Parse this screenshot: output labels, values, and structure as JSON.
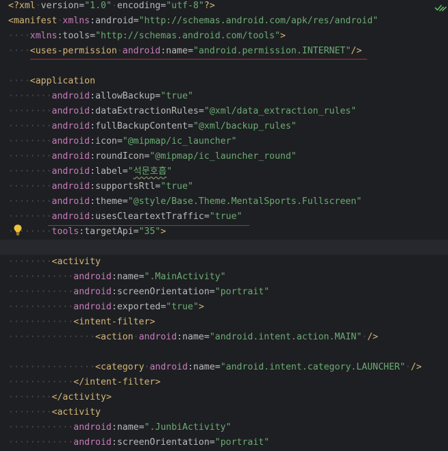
{
  "editor": {
    "lines": [
      "<?xml version=\"1.0\" encoding=\"utf-8\"?>",
      "<manifest xmlns:android=\"http://schemas.android.com/apk/res/android\"",
      "    xmlns:tools=\"http://schemas.android.com/tools\">",
      "    <uses-permission android:name=\"android.permission.INTERNET\"/>",
      "",
      "    <application",
      "        android:allowBackup=\"true\"",
      "        android:dataExtractionRules=\"@xml/data_extraction_rules\"",
      "        android:fullBackupContent=\"@xml/backup_rules\"",
      "        android:icon=\"@mipmap/ic_launcher\"",
      "        android:roundIcon=\"@mipmap/ic_launcher_round\"",
      "        android:label=\"석문호흡\"",
      "        android:supportsRtl=\"true\"",
      "        android:theme=\"@style/Base.Theme.MentalSports.Fullscreen\"",
      "        android:usesCleartextTraffic=\"true\"",
      "        tools:targetApi=\"35\">",
      "",
      "        <activity",
      "            android:name=\".MainActivity\"",
      "            android:screenOrientation=\"portrait\"",
      "            android:exported=\"true\">",
      "            <intent-filter>",
      "                <action android:name=\"android.intent.action.MAIN\" />",
      "",
      "                <category android:name=\"android.intent.category.LAUNCHER\" />",
      "            </intent-filter>",
      "        </activity>",
      "        <activity",
      "            android:name=\".JunbiActivity\"",
      "            android:screenOrientation=\"portrait\""
    ],
    "current_line_index": 16,
    "icons": {
      "inspection": "inspection-check-icon",
      "intention": "lightbulb-icon"
    },
    "colors": {
      "background": "#1e1f22",
      "tag": "#d5b778",
      "attribute": "#bababa",
      "namespace": "#c77dbb",
      "value": "#6aab73",
      "error_underline": "#c4262b",
      "bulb": "#f0c23a",
      "inspection_ok": "#5fb865"
    }
  }
}
